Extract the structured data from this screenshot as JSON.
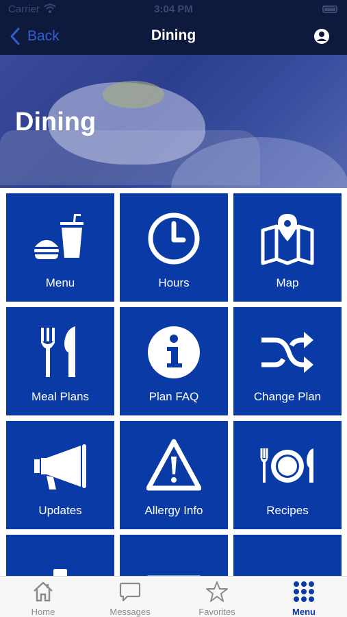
{
  "status_bar": {
    "carrier": "Carrier",
    "time": "3:04 PM"
  },
  "nav": {
    "back_label": "Back",
    "title": "Dining"
  },
  "hero": {
    "title": "Dining"
  },
  "tiles": [
    {
      "label": "Menu",
      "icon": "fastfood-icon"
    },
    {
      "label": "Hours",
      "icon": "clock-icon"
    },
    {
      "label": "Map",
      "icon": "map-icon"
    },
    {
      "label": "Meal Plans",
      "icon": "utensils-icon"
    },
    {
      "label": "Plan FAQ",
      "icon": "info-icon"
    },
    {
      "label": "Change Plan",
      "icon": "shuffle-icon"
    },
    {
      "label": "Updates",
      "icon": "megaphone-icon"
    },
    {
      "label": "Allergy Info",
      "icon": "warning-icon"
    },
    {
      "label": "Recipes",
      "icon": "plate-icon"
    },
    {
      "label": "",
      "icon": "clipboard-icon"
    },
    {
      "label": "",
      "icon": "envelope-icon"
    },
    {
      "label": "",
      "icon": "list-icon"
    }
  ],
  "tabbar": {
    "tabs": [
      {
        "label": "Home",
        "icon": "home-icon",
        "active": false
      },
      {
        "label": "Messages",
        "icon": "message-icon",
        "active": false
      },
      {
        "label": "Favorites",
        "icon": "star-icon",
        "active": false
      },
      {
        "label": "Menu",
        "icon": "grid-icon",
        "active": true
      }
    ]
  },
  "colors": {
    "nav_background": "#0e1a3d",
    "tile_blue": "#0a3aa6",
    "back_link": "#2f5fd0",
    "tab_inactive": "#8a8a8a"
  }
}
